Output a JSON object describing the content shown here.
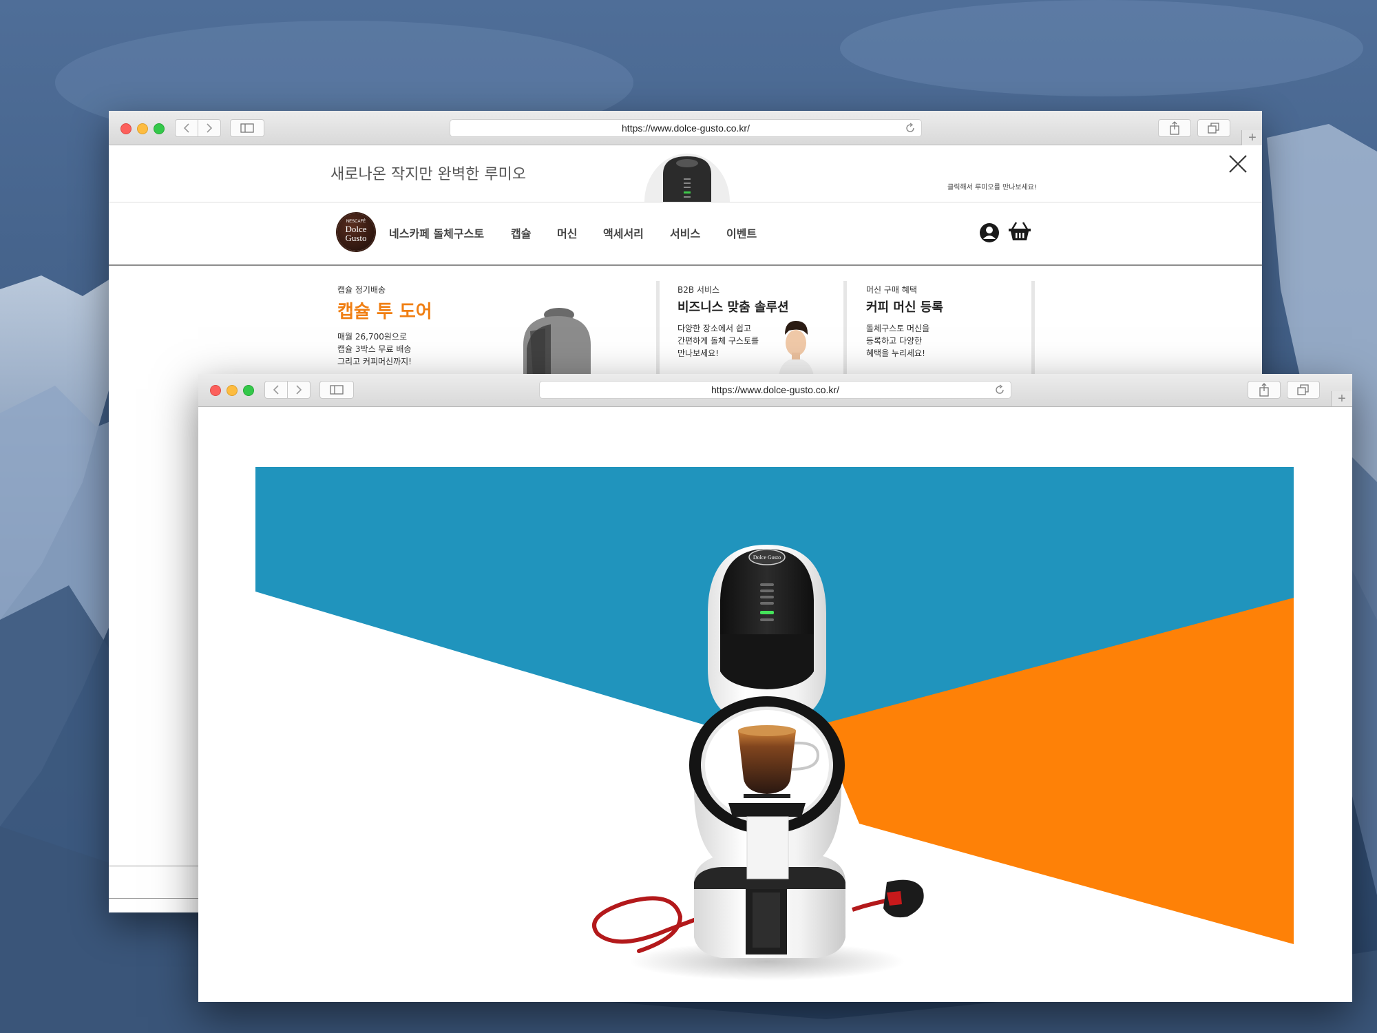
{
  "back_window": {
    "url": "https://www.dolce-gusto.co.kr/",
    "promo": {
      "title": "새로나온 작지만 완벽한 루미오",
      "link": "클릭해서 루미오를 만나보세요!"
    },
    "logo": {
      "line1": "NESCAFÉ",
      "line2": "Dolce",
      "line3": "Gusto"
    },
    "nav": [
      "네스카페 돌체구스토",
      "캡슐",
      "머신",
      "액세서리",
      "서비스",
      "이벤트"
    ],
    "cards": [
      {
        "label": "캡슐 정기배송",
        "title": "캡슐 투 도어",
        "body": "매월 26,700원으로\n캡슐 3박스 무료 배송\n그리고 커피머신까지!"
      },
      {
        "label": "B2B 서비스",
        "title": "비즈니스 맞춤 솔루션",
        "body": "다양한 장소에서 쉽고\n간편하게 돌체 구스토를\n만나보세요!"
      },
      {
        "label": "머신 구매 혜택",
        "title": "커피 머신 등록",
        "body": "돌체구스토 머신을\n등록하고 다양한\n혜택을 누리세요!"
      }
    ]
  },
  "front_window": {
    "url": "https://www.dolce-gusto.co.kr/",
    "hero": {
      "colors": {
        "blue": "#2094bd",
        "orange": "#fe8107",
        "white": "#ffffff"
      },
      "machine_logo": "Dolce Gusto"
    }
  },
  "icons": {
    "back": "chevron-left-icon",
    "forward": "chevron-right-icon",
    "sidebar": "sidebar-icon",
    "share": "share-icon",
    "tabs": "tabs-icon",
    "reload": "reload-icon",
    "close": "close-icon",
    "account": "account-icon",
    "cart": "basket-icon"
  }
}
